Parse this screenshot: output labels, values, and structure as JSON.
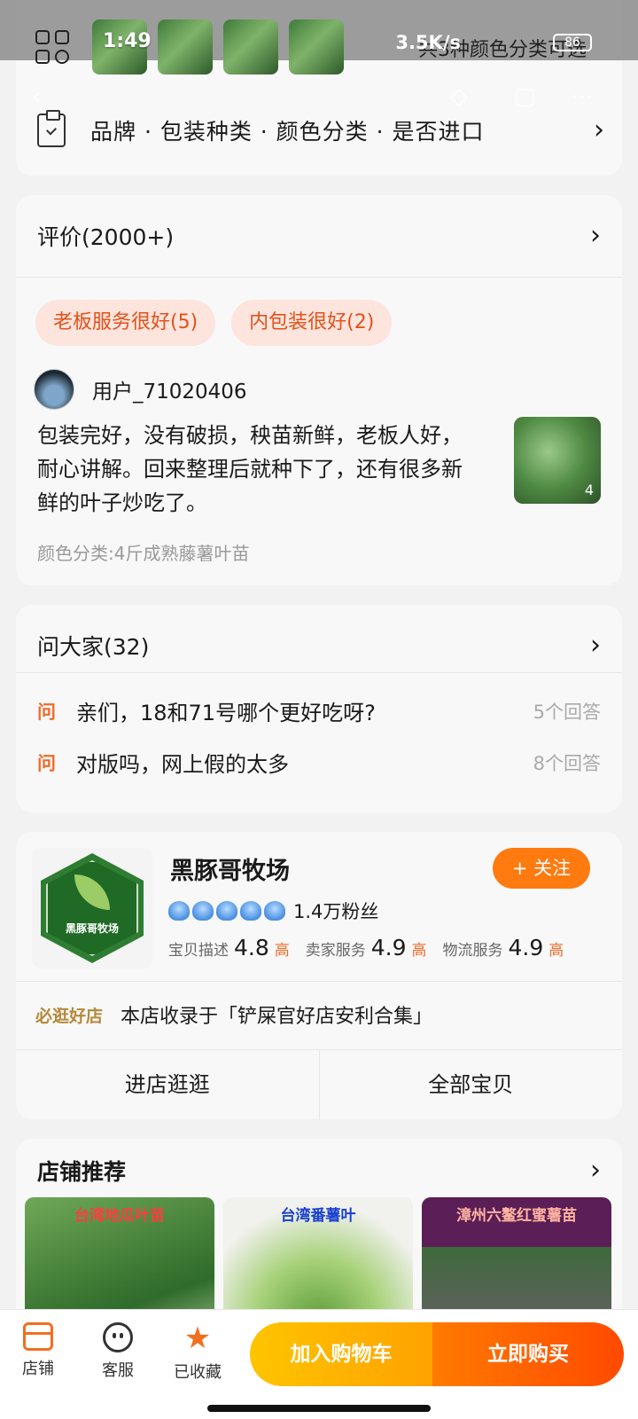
{
  "status_bar": {
    "time": "1:49",
    "network_speed": "3.5K/s",
    "battery": "86",
    "hidden_text": "共3种颜色分类可选"
  },
  "spec": {
    "text": "品牌 · 包装种类 · 颜色分类 · 是否进口"
  },
  "reviews": {
    "title": "评价(2000+)",
    "tags": [
      "老板服务很好(5)",
      "内包装很好(2)"
    ],
    "reviewer": "用户_71020406",
    "text": "包装完好，没有破损，秧苗新鲜，老板人好，耐心讲解。回来整理后就种下了，还有很多新鲜的叶子炒吃了。",
    "image_count": "4",
    "variant": "颜色分类:4斤成熟藤薯叶苗"
  },
  "qa": {
    "title": "问大家(32)",
    "mark": "问",
    "items": [
      {
        "question": "亲们，18和71号哪个更好吃呀?",
        "answers": "5个回答"
      },
      {
        "question": "对版吗，网上假的太多",
        "answers": "8个回答"
      }
    ]
  },
  "shop": {
    "name": "黑豚哥牧场",
    "logo_text": "黑豚哥牧场",
    "follow_label": "+ 关注",
    "fans": "1.4万粉丝",
    "ratings": [
      {
        "label": "宝贝描述",
        "value": "4.8",
        "level": "高"
      },
      {
        "label": "卖家服务",
        "value": "4.9",
        "level": "高"
      },
      {
        "label": "物流服务",
        "value": "4.9",
        "level": "高"
      }
    ],
    "badge_label": "必逛好店",
    "badge_text": "本店收录于「铲屎官好店安利合集」",
    "enter_label": "进店逛逛",
    "all_items_label": "全部宝贝"
  },
  "recommend": {
    "title": "店铺推荐",
    "items": [
      {
        "label": "台湾地瓜叶苗"
      },
      {
        "label": "台湾番薯叶"
      },
      {
        "label": "漳州六鳌红蜜薯苗"
      }
    ]
  },
  "bottom_bar": {
    "store_label": "店铺",
    "service_label": "客服",
    "favorite_label": "已收藏",
    "cart_label": "加入购物车",
    "buy_label": "立即购买"
  },
  "colors": {
    "accent": "#f26f21",
    "cart_button": "#ffb300",
    "buy_button": "#ff5a00",
    "tag_bg": "#fde4dc"
  }
}
